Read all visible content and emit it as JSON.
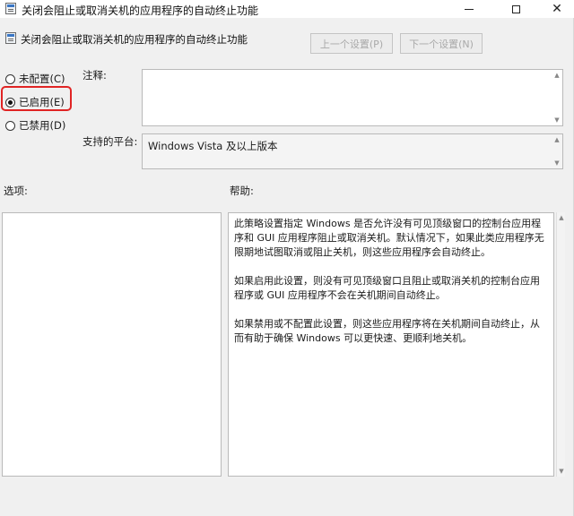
{
  "window": {
    "title": "关闭会阻止或取消关机的应用程序的自动终止功能",
    "close_glyph": "✕"
  },
  "header": {
    "title": "关闭会阻止或取消关机的应用程序的自动终止功能",
    "prev_label": "上一个设置(P)",
    "next_label": "下一个设置(N)"
  },
  "state": {
    "options": [
      {
        "label": "未配置(C)",
        "checked": false
      },
      {
        "label": "已启用(E)",
        "checked": true
      },
      {
        "label": "已禁用(D)",
        "checked": false
      }
    ]
  },
  "labels": {
    "comment": "注释:",
    "platform": "支持的平台:",
    "options": "选项:",
    "help": "帮助:"
  },
  "platform_value": "Windows Vista 及以上版本",
  "help_text": [
    "此策略设置指定 Windows 是否允许没有可见顶级窗口的控制台应用程序和 GUI 应用程序阻止或取消关机。默认情况下，如果此类应用程序无限期地试图取消或阻止关机，则这些应用程序会自动终止。",
    "如果启用此设置，则没有可见顶级窗口且阻止或取消关机的控制台应用程序或 GUI 应用程序不会在关机期间自动终止。",
    "如果禁用或不配置此设置，则这些应用程序将在关机期间自动终止，从而有助于确保 Windows 可以更快速、更顺利地关机。"
  ],
  "colors": {
    "highlight": "#e02424",
    "window_bg": "#f0f0f0",
    "disabled_text": "#a9a9a9"
  }
}
